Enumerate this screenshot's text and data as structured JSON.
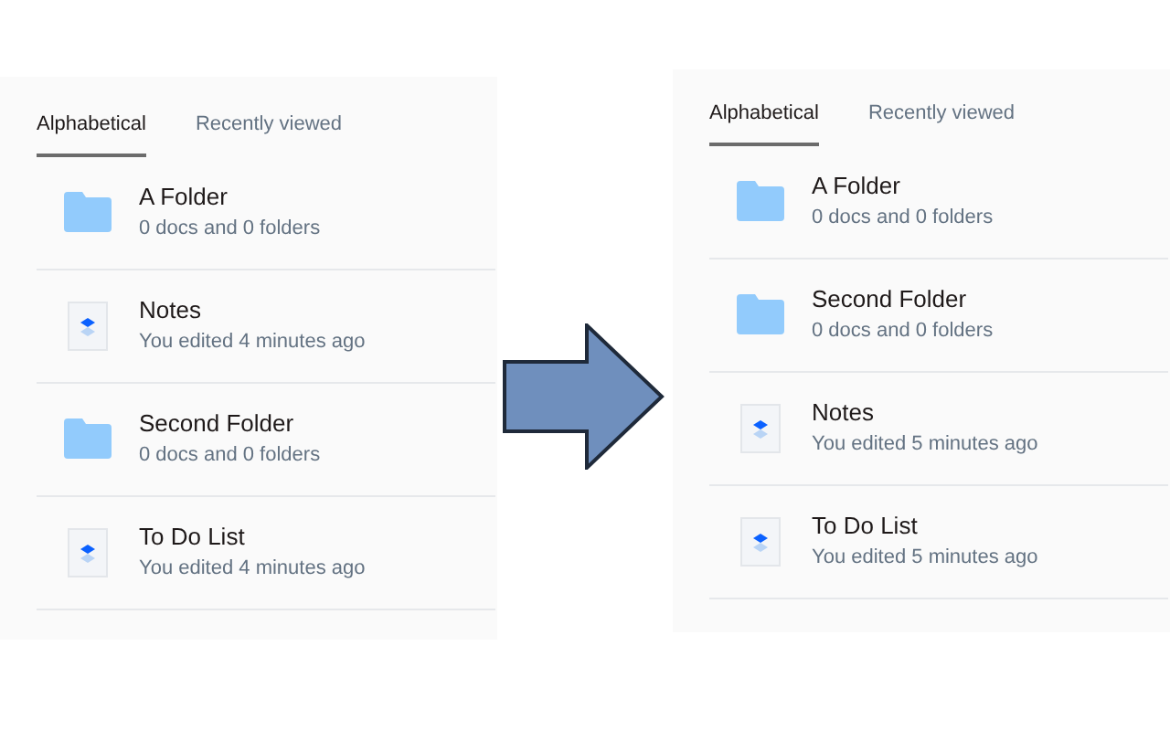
{
  "panels": [
    {
      "tabs": [
        {
          "label": "Alphabetical",
          "selected": true
        },
        {
          "label": "Recently viewed",
          "selected": false
        }
      ],
      "items": [
        {
          "kind": "folder",
          "name": "A Folder",
          "detail": "0 docs and 0 folders"
        },
        {
          "kind": "doc",
          "name": "Notes",
          "detail": "You edited 4 minutes ago"
        },
        {
          "kind": "folder",
          "name": "Second Folder",
          "detail": "0 docs and 0 folders"
        },
        {
          "kind": "doc",
          "name": "To Do List",
          "detail": "You edited 4 minutes ago"
        }
      ]
    },
    {
      "tabs": [
        {
          "label": "Alphabetical",
          "selected": true
        },
        {
          "label": "Recently viewed",
          "selected": false
        }
      ],
      "items": [
        {
          "kind": "folder",
          "name": "A Folder",
          "detail": "0 docs and 0 folders"
        },
        {
          "kind": "folder",
          "name": "Second Folder",
          "detail": "0 docs and 0 folders"
        },
        {
          "kind": "doc",
          "name": "Notes",
          "detail": "You edited 5 minutes ago"
        },
        {
          "kind": "doc",
          "name": "To Do List",
          "detail": "You edited 5 minutes ago"
        }
      ]
    }
  ]
}
